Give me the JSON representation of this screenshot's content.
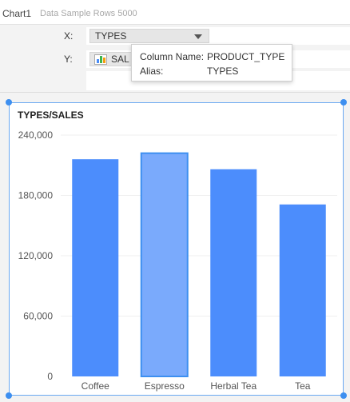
{
  "header": {
    "chart_name": "Chart1",
    "data_source": "Data Sample Rows 5000"
  },
  "bindings": {
    "x_label": "X:",
    "x_field": "TYPES",
    "y_label": "Y:",
    "y_field": "SALES",
    "y_field_visible": "SAL"
  },
  "tooltip": {
    "column_key": "Column Name:",
    "column_value": "PRODUCT_TYPE",
    "alias_key": "Alias:",
    "alias_value": "TYPES"
  },
  "colors": {
    "bar": "#4c8dfc",
    "bar_selected": "#7aaafc",
    "selection": "#3d8ff0"
  },
  "icons": {
    "y_field_icon": "bar-chart-icon",
    "dropdown": "chevron-down-icon"
  },
  "chart_data": {
    "type": "bar",
    "title": "TYPES/SALES",
    "categories": [
      "Coffee",
      "Espresso",
      "Herbal Tea",
      "Tea"
    ],
    "values": [
      216000,
      222000,
      206000,
      171000
    ],
    "ylim": [
      0,
      240000
    ],
    "yticks": [
      0,
      60000,
      120000,
      180000,
      240000
    ],
    "ytick_labels": [
      "0",
      "60,000",
      "120,000",
      "180,000",
      "240,000"
    ],
    "selected_category": "Espresso",
    "grid": true
  }
}
